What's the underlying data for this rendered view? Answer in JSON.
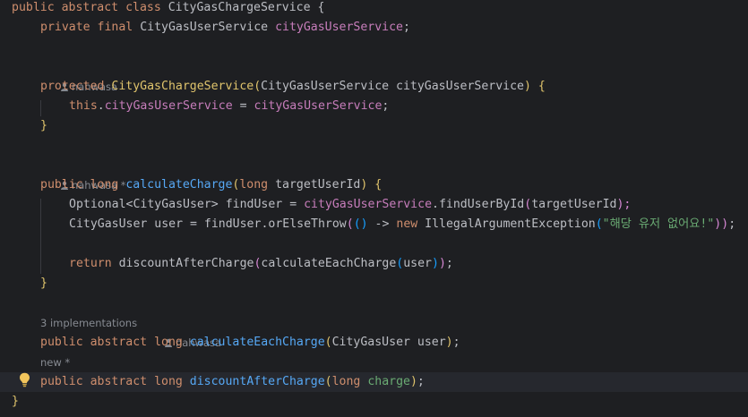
{
  "hints": {
    "author": "nahwasa",
    "author_modified": "nahwasa *",
    "implementations": "3 implementations",
    "new_modified": "new *"
  },
  "code": {
    "l1": [
      "public",
      "abstract",
      "class",
      "CityGasChargeService",
      "{"
    ],
    "l2": [
      "private",
      "final",
      "CityGasUserService",
      "cityGasUserService",
      ";"
    ],
    "l3": [
      "protected",
      "CityGasChargeService",
      "(",
      "CityGasUserService",
      "cityGasUserService",
      ")",
      "{"
    ],
    "l4": [
      "this",
      ".",
      "cityGasUserService",
      "=",
      "cityGasUserService",
      ";"
    ],
    "l5": [
      "}"
    ],
    "l6": [
      "public",
      "long",
      "calculateCharge",
      "(",
      "long",
      "targetUserId",
      ")",
      "{"
    ],
    "l7": [
      "Optional",
      "<CityGasUser>",
      "findUser",
      "=",
      "cityGasUserService",
      ".findUserById",
      "(",
      "targetUserId",
      ");"
    ],
    "l8": [
      "CityGasUser",
      "user",
      "=",
      "findUser",
      ".orElseThrow",
      "(",
      "()",
      "->",
      "new",
      "IllegalArgumentException",
      "(",
      "\"해당 유저 없어요!\"",
      "))",
      ";"
    ],
    "l9": [
      "return",
      "discountAfterCharge",
      "(",
      "calculateEachCharge",
      "(",
      "user",
      ")",
      ")",
      ";"
    ],
    "l10": [
      "}"
    ],
    "l11": [
      "public",
      "abstract",
      "long",
      "calculateEachCharge",
      "(",
      "CityGasUser",
      "user",
      ")",
      ";"
    ],
    "l12": [
      "public",
      "abstract",
      "long",
      "discountAfterCharge",
      "(",
      "long",
      "charge",
      ")",
      ";"
    ],
    "l13": [
      "}"
    ]
  },
  "colors": {
    "background": "#1e1f22",
    "keyword": "#cf8e6d",
    "method": "#56a8f5",
    "field": "#c77dbb",
    "string": "#6aab73",
    "text": "#bcbec4",
    "hint": "#868a91",
    "current_line": "#26282e"
  },
  "icons": {
    "intention": "lightbulb-icon",
    "author": "person-icon"
  }
}
